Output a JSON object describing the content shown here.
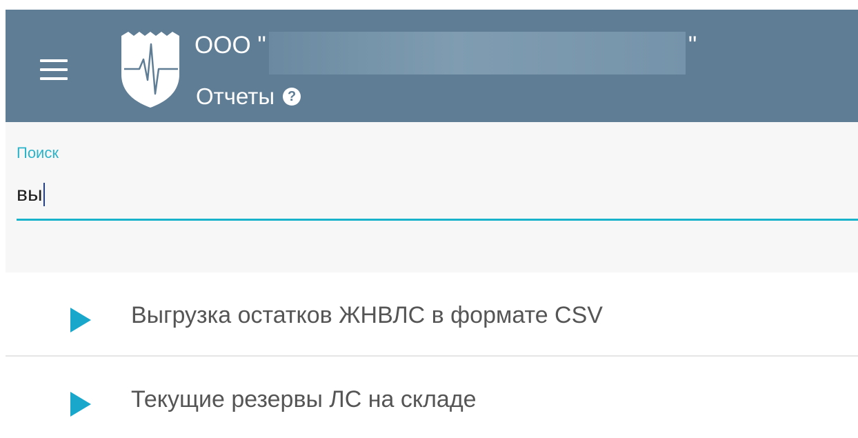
{
  "header": {
    "org_prefix": "ООО \"",
    "org_suffix": "\"",
    "section_title": "Отчеты",
    "help_symbol": "?",
    "background_color": "#5f7d95"
  },
  "search": {
    "label": "Поиск",
    "value": "вы",
    "accent_color": "#19b3cc"
  },
  "reports": [
    {
      "label": "Выгрузка остатков ЖНВЛС в формате CSV"
    },
    {
      "label": "Текущие резервы ЛС на складе"
    }
  ],
  "icons": {
    "menu": "hamburger-menu-icon",
    "logo": "coat-of-arms-heartbeat-logo",
    "help": "question-circle-icon",
    "expand": "play-triangle-icon"
  }
}
